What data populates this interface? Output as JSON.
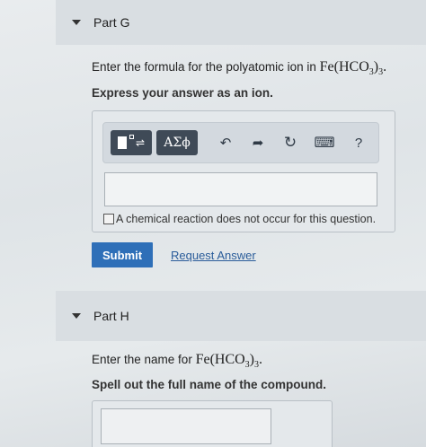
{
  "partG": {
    "title": "Part G",
    "prompt_prefix": "Enter the formula for the polyatomic ion in ",
    "formula_main": "Fe(HCO",
    "formula_sub1": "3",
    "formula_close": ")",
    "formula_sub2": "3",
    "formula_end": ".",
    "instruction": "Express your answer as an ion.",
    "toolbar": {
      "templates_label": "■⁰⇌",
      "greek_label": "ΑΣϕ",
      "undo_glyph": "↶",
      "redo_glyph": "➦",
      "reset_glyph": "↻",
      "keyboard_glyph": "⌨",
      "help_glyph": "?"
    },
    "input_value": "",
    "checkbox_label": "A chemical reaction does not occur for this question.",
    "submit_label": "Submit",
    "request_label": "Request Answer"
  },
  "partH": {
    "title": "Part H",
    "prompt_prefix": "Enter the name for ",
    "formula_main": "Fe(HCO",
    "formula_sub1": "3",
    "formula_close": ")",
    "formula_sub2": "3",
    "formula_end": ".",
    "instruction": "Spell out the full name of the compound.",
    "input_value": ""
  }
}
